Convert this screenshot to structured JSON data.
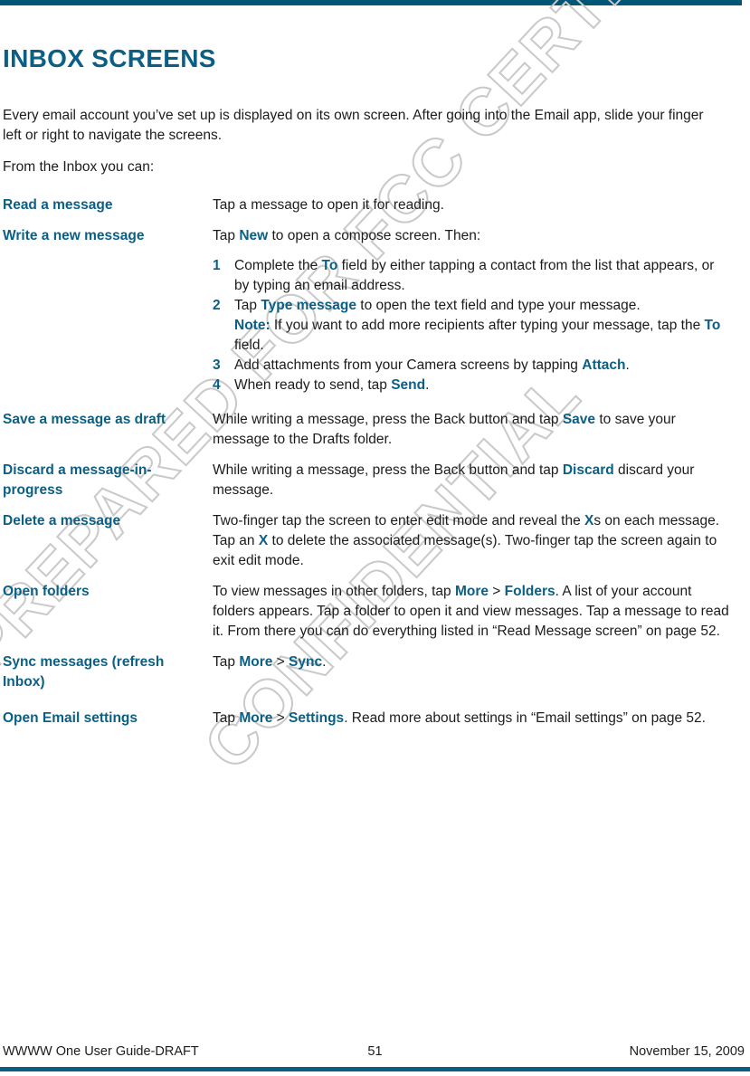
{
  "document": {
    "title": "INBOX SCREENS",
    "accent_color": "#0b5f85",
    "rule_color": "#005677",
    "body_color": "#1c1c1c"
  },
  "watermark": {
    "line1": "PREPARED FOR FCC CERTIFICATION",
    "line2": "CONFIDENTIAL",
    "color": "#c9c9c9"
  },
  "intro": {
    "paragraph1": "Every email account you’ve set up is displayed on its own screen. After going into the Email app, slide your finger left or right to navigate the screens.",
    "paragraph2": "From the Inbox you can:"
  },
  "rows": [
    {
      "term": "Read a message",
      "desc": "Tap a message to open it for reading."
    },
    {
      "term": "Write a new message",
      "lead_pre": "Tap ",
      "lead_key": "New",
      "lead_post": " to open a compose screen. Then:",
      "steps": [
        {
          "num": "1",
          "pre": "Complete the ",
          "key": "To",
          "post": " field by either tapping a contact from the list that appears, or by typing an email address."
        },
        {
          "num": "2",
          "pre": "Tap ",
          "key": "Type message",
          "post": " to open the text field and type your message.",
          "note_label": "Note:",
          "note_pre": " If you want to add more recipients after typing your message, tap the ",
          "note_key": "To",
          "note_post": " field."
        },
        {
          "num": "3",
          "pre": "Add attachments from your Camera screens by tapping ",
          "key": "Attach",
          "post": "."
        },
        {
          "num": "4",
          "pre": "When ready to send, tap ",
          "key": "Send",
          "post": "."
        }
      ]
    },
    {
      "term": "Save a message as draft",
      "pre": "While writing a message, press the Back button and tap ",
      "key": "Save",
      "post": " to save your message to the Drafts folder."
    },
    {
      "term": "Discard a message-in-progress",
      "pre": "While writing a message, press the Back button and tap ",
      "key": "Discard",
      "post": " discard your message."
    },
    {
      "term": "Delete a message",
      "pre": "Two-finger tap the screen to enter edit mode and reveal the ",
      "key": "X",
      "mid": "s on each message. Tap an ",
      "key2": "X",
      "post": " to delete the associated message(s). Two-finger tap the screen again to exit edit mode."
    },
    {
      "term": "Open folders",
      "pre": "To view messages in other folders, tap ",
      "key": "More",
      "sep": " > ",
      "key2": "Folders",
      "post": ". A list of your account folders appears. Tap a folder to open it and view messages. Tap a message to read it. From there you can do everything listed in “Read Message screen” on page 52."
    },
    {
      "term": "Sync messages (refresh Inbox)",
      "pre": "Tap ",
      "key": "More",
      "sep": " > ",
      "key2": "Sync",
      "post": "."
    },
    {
      "term": "Open Email settings",
      "pre": "Tap ",
      "key": "More",
      "sep": " > ",
      "key2": "Settings",
      "post": ". Read more about settings in “Email settings” on page 52."
    }
  ],
  "footer": {
    "left": "WWWW One User Guide-DRAFT",
    "page_number": "51",
    "right": "November 15, 2009"
  }
}
